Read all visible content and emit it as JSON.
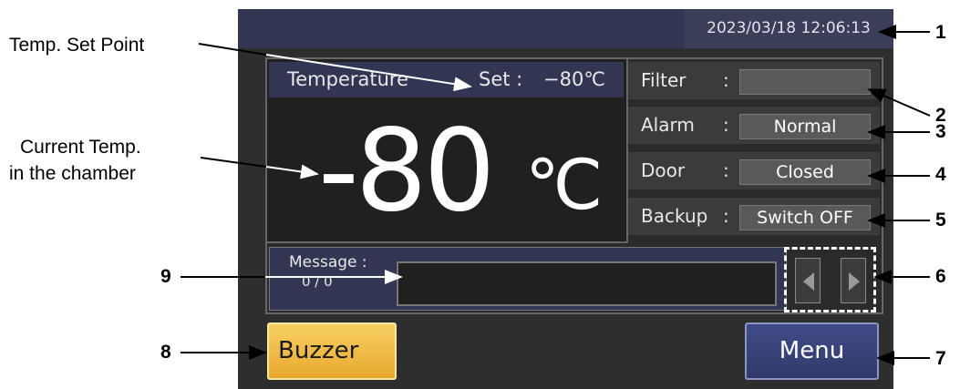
{
  "screen": {
    "datetime": "2023/03/18  12:06:13",
    "temperature": {
      "label": "Temperature",
      "set_label": "Set :",
      "set_value": "−80℃",
      "current_value": "-80",
      "unit": "℃"
    },
    "status": [
      {
        "label": "Filter",
        "colon": ":",
        "value": ""
      },
      {
        "label": "Alarm",
        "colon": ":",
        "value": "Normal"
      },
      {
        "label": "Door",
        "colon": ":",
        "value": "Closed"
      },
      {
        "label": "Backup",
        "colon": ":",
        "value": "Switch OFF"
      }
    ],
    "message": {
      "label": "Message :",
      "count": "0 / 0",
      "text": ""
    },
    "buttons": {
      "buzzer": "Buzzer",
      "menu": "Menu"
    }
  },
  "callouts": {
    "set_point": "Temp. Set Point",
    "current_line1": "Current  Temp.",
    "current_line2": "in the chamber",
    "numbers": [
      "1",
      "2",
      "3",
      "4",
      "5",
      "6",
      "7",
      "8",
      "9"
    ]
  },
  "colors": {
    "buzzer": "#f0bd45",
    "menu": "#3a4479",
    "header": "#323653"
  }
}
